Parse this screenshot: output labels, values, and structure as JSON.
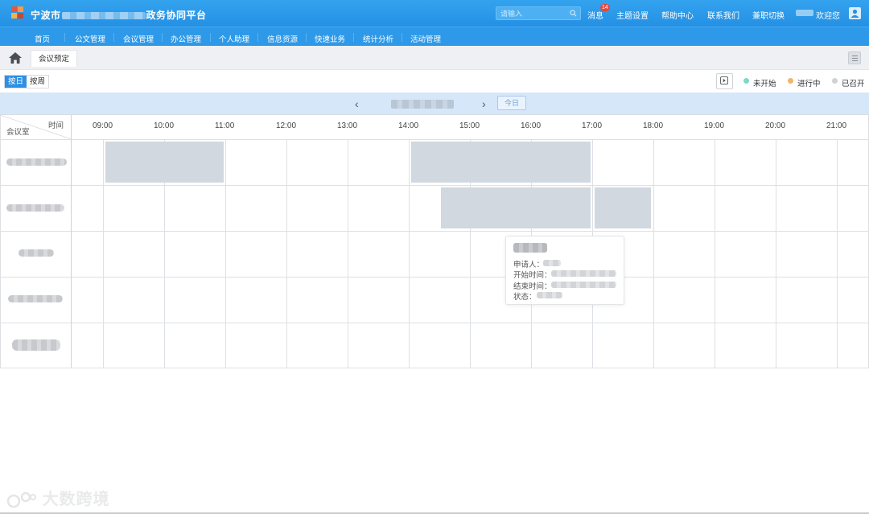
{
  "header": {
    "title_prefix": "宁波市",
    "title_suffix": "政务协同平台",
    "search_placeholder": "请输入",
    "nav": [
      "消息",
      "主题设置",
      "帮助中心",
      "联系我们",
      "兼职切换"
    ],
    "message_badge": "14",
    "welcome": "欢迎您"
  },
  "menu": [
    "首页",
    "公文管理",
    "会议管理",
    "办公管理",
    "个人助理",
    "信息资源",
    "快速业务",
    "统计分析",
    "活动管理"
  ],
  "tabs": {
    "active": "会议预定"
  },
  "toolbar": {
    "view_day": "按日",
    "view_week": "按周",
    "legend": [
      {
        "label": "未开始",
        "color": "#7fd8c8"
      },
      {
        "label": "进行中",
        "color": "#f5b46b"
      },
      {
        "label": "已召开",
        "color": "#cfd2d6"
      }
    ]
  },
  "datebar": {
    "today": "今日"
  },
  "grid": {
    "corner_time": "时间",
    "corner_room": "会议室",
    "hours": [
      "09:00",
      "10:00",
      "11:00",
      "12:00",
      "13:00",
      "14:00",
      "15:00",
      "16:00",
      "17:00",
      "18:00",
      "19:00",
      "20:00",
      "21:00"
    ],
    "booking_color": "#d1d8df"
  },
  "tooltip": {
    "applicant_label": "申请人：",
    "start_label": "开始时间：",
    "end_label": "结束时间：",
    "status_label": "状态："
  },
  "watermark": "大数跨境"
}
